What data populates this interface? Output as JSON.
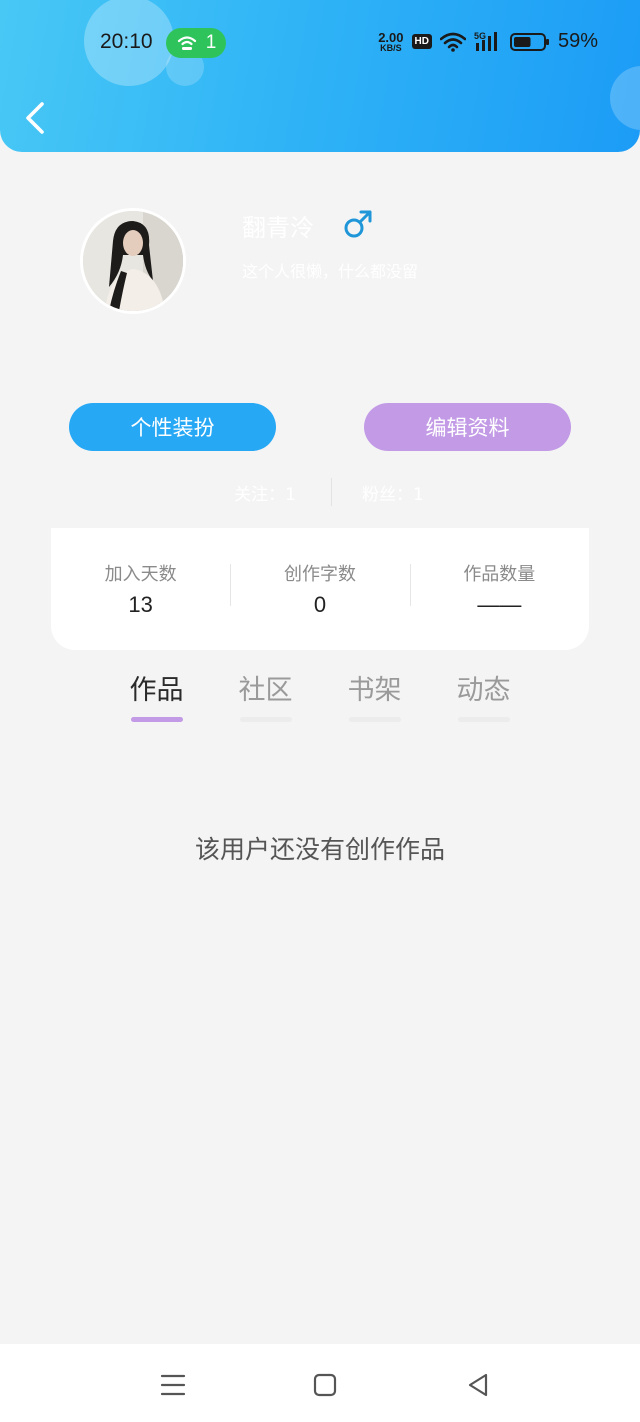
{
  "status_bar": {
    "time": "20:10",
    "hotspot_count": "1",
    "net_speed_value": "2.00",
    "net_speed_unit": "KB/S",
    "hd_label": "HD",
    "network_label": "5G",
    "battery_percent": "59%",
    "battery_level": 0.59
  },
  "profile": {
    "username": "翻青泠",
    "gender": "male",
    "bio": "这个人很懒，什么都没留"
  },
  "actions": {
    "dressup_label": "个性装扮",
    "edit_label": "编辑资料"
  },
  "social": {
    "follow_text": "关注：1",
    "fans_text": "粉丝：1"
  },
  "stats": [
    {
      "label": "加入天数",
      "value": "13"
    },
    {
      "label": "创作字数",
      "value": "0"
    },
    {
      "label": "作品数量",
      "value": "——"
    }
  ],
  "tabs": [
    {
      "label": "作品",
      "active": true
    },
    {
      "label": "社区",
      "active": false
    },
    {
      "label": "书架",
      "active": false
    },
    {
      "label": "动态",
      "active": false
    }
  ],
  "empty_message": "该用户还没有创作作品",
  "colors": {
    "header_start": "#48c8f5",
    "header_end": "#1c9cf6",
    "dressup_button": "#27a8f5",
    "edit_button": "#c29ae6",
    "tab_indicator": "#c29ae6",
    "gender_icon": "#1e96d8",
    "hotspot_pill": "#2fc35b"
  }
}
